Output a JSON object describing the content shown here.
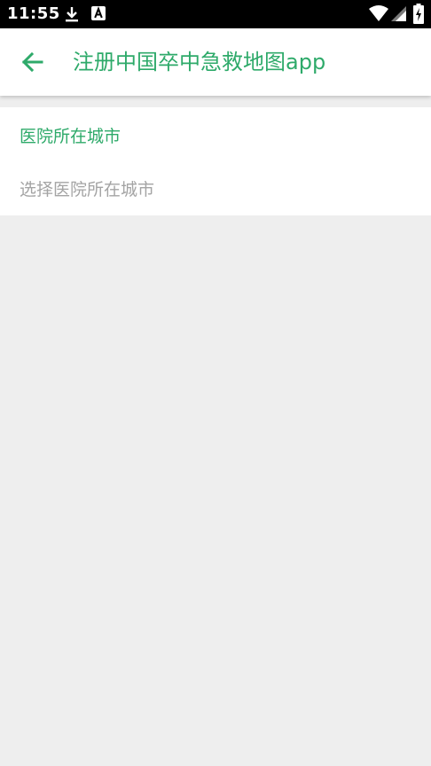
{
  "status_bar": {
    "time": "11:55",
    "icons": [
      "download-icon",
      "a-notification-icon",
      "wifi-icon",
      "signal-icon",
      "battery-charging-icon"
    ]
  },
  "app_bar": {
    "back_icon": "arrow-back-icon",
    "title": "注册中国卒中急救地图app"
  },
  "form": {
    "city_label": "医院所在城市",
    "city_placeholder": "选择医院所在城市"
  },
  "colors": {
    "accent": "#2eaa6a",
    "background": "#eeeeee",
    "placeholder": "#a4a4a4",
    "status_bar": "#000000"
  }
}
